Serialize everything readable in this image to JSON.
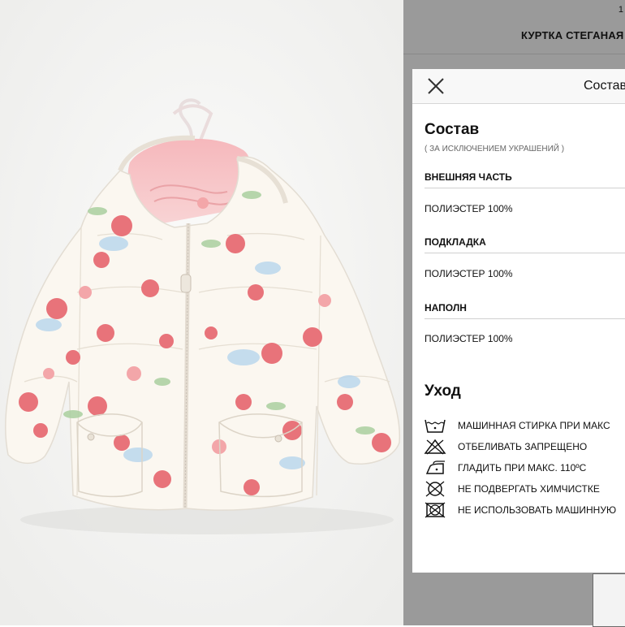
{
  "header": {
    "page_number": "1",
    "product_title": "КУРТКА СТЕГАНАЯ"
  },
  "modal": {
    "header_title": "Состав",
    "composition_title": "Состав",
    "composition_note": "( ЗА ИСКЛЮЧЕНИЕМ УКРАШЕНИЙ )",
    "parts": [
      {
        "label": "ВНЕШНЯЯ ЧАСТЬ",
        "value": "ПОЛИЭСТЕР 100%"
      },
      {
        "label": "ПОДКЛАДКА",
        "value": "ПОЛИЭСТЕР 100%"
      },
      {
        "label": "НАПОЛН",
        "value": "ПОЛИЭСТЕР 100%"
      }
    ],
    "care_title": "Уход",
    "care": [
      {
        "icon": "wash-icon",
        "text": "МАШИННАЯ СТИРКА ПРИ МАКС"
      },
      {
        "icon": "no-bleach-icon",
        "text": "ОТБЕЛИВАТЬ ЗАПРЕЩЕНО"
      },
      {
        "icon": "iron-icon",
        "text": "ГЛАДИТЬ ПРИ МАКС. 110ºC"
      },
      {
        "icon": "no-dry-clean-icon",
        "text": "НЕ ПОДВЕРГАТЬ ХИМЧИСТКЕ"
      },
      {
        "icon": "no-tumble-dry-icon",
        "text": "НЕ ИСПОЛЬЗОВАТЬ МАШИННУЮ"
      }
    ]
  },
  "colors": {
    "overlay": "#9a9a9a",
    "jacket": "#fbf7f0",
    "lining": "#f5c3c6",
    "rose": "#e8737a",
    "leaf": "#a9cf9f",
    "blue_flower": "#b7d4ec"
  }
}
